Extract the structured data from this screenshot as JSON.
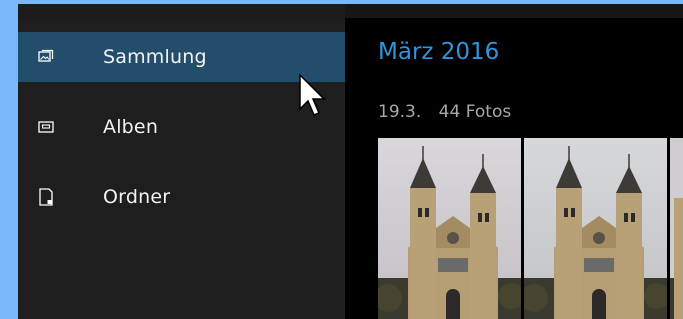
{
  "sidebar": {
    "items": [
      {
        "label": "Sammlung",
        "icon": "photo-collection-icon",
        "selected": true
      },
      {
        "label": "Alben",
        "icon": "album-icon",
        "selected": false
      },
      {
        "label": "Ordner",
        "icon": "folder-icon",
        "selected": false
      }
    ]
  },
  "content": {
    "month_title": "März 2016",
    "date": "19.3.",
    "photo_count": "44 Fotos",
    "photos": [
      {
        "icon": "church-photo-thumbnail"
      },
      {
        "icon": "church-photo-thumbnail"
      },
      {
        "icon": "church-photo-thumbnail"
      }
    ]
  },
  "colors": {
    "accent": "#2f95dc",
    "selected_bg": "#234e6b",
    "sidebar_bg": "#1e1e1e",
    "desktop_bg": "#7ab8f7"
  }
}
